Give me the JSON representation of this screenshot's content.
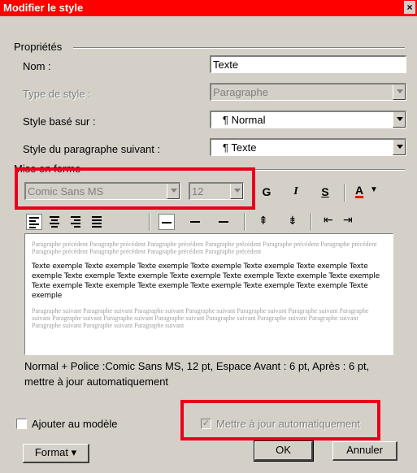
{
  "window": {
    "title": "Modifier le style",
    "close_label": "×"
  },
  "properties": {
    "group_label": "Propriétés",
    "name_label": "Nom :",
    "name_value": "Texte",
    "type_label": "Type de style :",
    "type_value": "Paragraphe",
    "based_on_label": "Style basé sur :",
    "based_on_value": "¶ Normal",
    "next_label": "Style du paragraphe suivant :",
    "next_value": "¶ Texte"
  },
  "format": {
    "group_label": "Mise en forme",
    "font_name": "Comic Sans MS",
    "font_size": "12",
    "bold_label": "G",
    "italic_label": "I",
    "underline_label": "S",
    "color_label": "A"
  },
  "preview": {
    "prev_para_text": "Paragraphe précédent Paragraphe précédent Paragraphe précédent Paragraphe précédent Paragraphe précédent Paragraphe précédent Paragraphe précédent Paragraphe précédent Paragraphe précédent Paragraphe précédent",
    "sample_text": "Texte exemple Texte exemple Texte exemple Texte exemple Texte exemple Texte exemple Texte exemple Texte exemple Texte exemple Texte exemple Texte exemple Texte exemple Texte exemple Texte exemple Texte exemple Texte exemple Texte exemple Texte exemple Texte exemple Texte exemple",
    "next_para_text": "Paragraphe suivant Paragraphe suivant Paragraphe suivant Paragraphe suivant Paragraphe suivant Paragraphe suivant Paragraphe suivant Paragraphe suivant Paragraphe suivant Paragraphe suivant Paragraphe suivant Paragraphe suivant Paragraphe suivant Paragraphe suivant Paragraphe suivant Paragraphe suivant"
  },
  "description": "Normal + Police :Comic Sans MS, 12 pt, Espace Avant : 6 pt, Après : 6 pt, mettre à jour automatiquement",
  "footer": {
    "add_to_template_label": "Ajouter au modèle",
    "auto_update_label": "Mettre à jour automatiquement",
    "format_button": "Format ▾",
    "ok_button": "OK",
    "cancel_button": "Annuler"
  },
  "colors": {
    "highlight": "#e8001c",
    "title_bar": "#ff0000",
    "font_color_bar": "#ff0000"
  }
}
